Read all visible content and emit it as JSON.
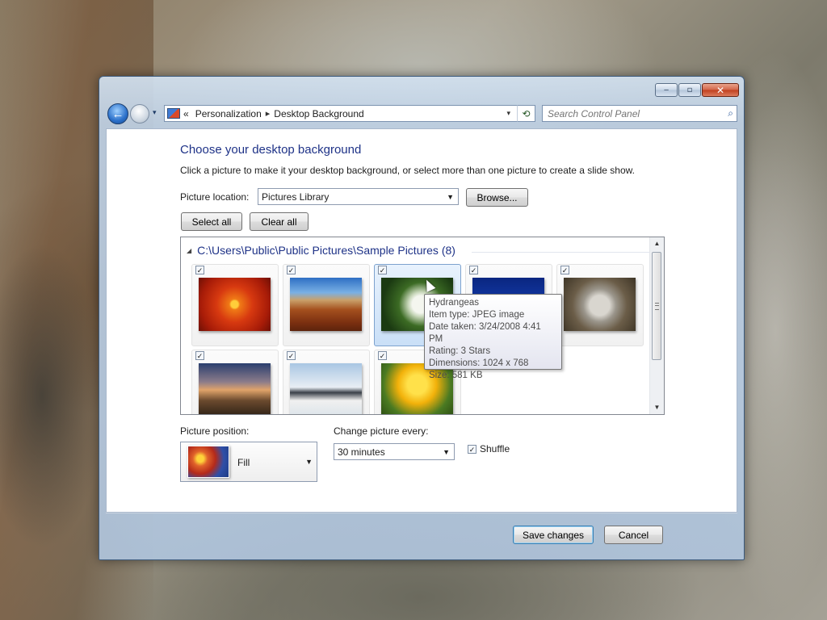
{
  "window": {
    "caption_buttons": {
      "minimize": "‒",
      "maximize": "▫",
      "close": "✕"
    }
  },
  "navbar": {
    "back_icon": "←",
    "dropdown_icon": "▾",
    "breadcrumb_prefix": "«",
    "breadcrumb": [
      "Personalization",
      "Desktop Background"
    ],
    "crumb_separator": "▸",
    "refresh_icon": "⟲",
    "search_placeholder": "Search Control Panel",
    "search_icon": "⌕"
  },
  "page": {
    "title": "Choose your desktop background",
    "subtitle": "Click a picture to make it your desktop background, or select more than one picture to create a slide show.",
    "location_label": "Picture location:",
    "location_value": "Pictures Library",
    "browse_label": "Browse...",
    "select_all_label": "Select all",
    "clear_all_label": "Clear all"
  },
  "gallery": {
    "group_header": "C:\\Users\\Public\\Public Pictures\\Sample Pictures (8)",
    "collapse_icon": "◢",
    "check_mark": "✓",
    "pictures": [
      {
        "name": "Chrysanthemum",
        "checked": true
      },
      {
        "name": "Desert",
        "checked": true
      },
      {
        "name": "Hydrangeas",
        "checked": true
      },
      {
        "name": "Jellyfish",
        "checked": true
      },
      {
        "name": "Koala",
        "checked": true
      },
      {
        "name": "Lighthouse",
        "checked": true
      },
      {
        "name": "Penguins",
        "checked": true
      },
      {
        "name": "Tulips",
        "checked": true
      }
    ],
    "scroll_up": "▲",
    "scroll_down": "▼"
  },
  "tooltip": {
    "name": "Hydrangeas",
    "type": "Item type: JPEG image",
    "date": "Date taken: 3/24/2008 4:41 PM",
    "rating": "Rating: 3 Stars",
    "dimensions": "Dimensions: 1024 x 768",
    "size": "Size: 581 KB"
  },
  "options": {
    "position_label": "Picture position:",
    "position_value": "Fill",
    "interval_label": "Change picture every:",
    "interval_value": "30 minutes",
    "shuffle_label": "Shuffle",
    "shuffle_checked": true,
    "dropdown_icon": "▼"
  },
  "footer": {
    "save_label": "Save changes",
    "cancel_label": "Cancel"
  }
}
